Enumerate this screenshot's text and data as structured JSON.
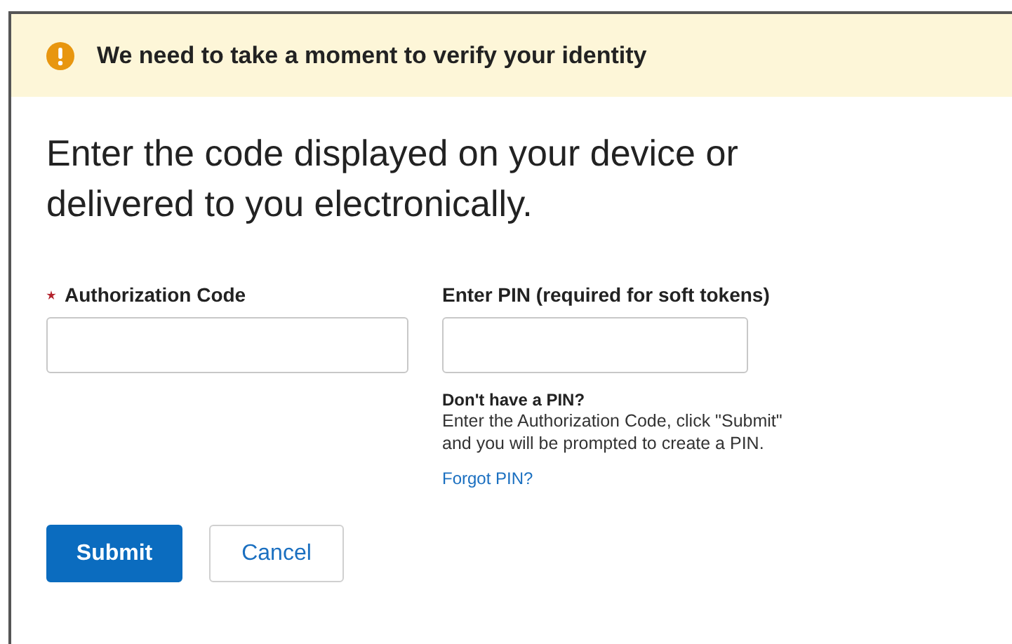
{
  "alert": {
    "kind": "warning",
    "message": "We need to take a moment to verify your identity"
  },
  "heading": "Enter the code displayed on your device or delivered to you electronically.",
  "fields": [
    {
      "label": "Authorization Code",
      "required": true
    },
    {
      "label": "Enter PIN (required for soft tokens)",
      "required": false,
      "help_title": "Don't have a PIN?",
      "help_text": "Enter the Authorization Code, click \"Submit\" and you will be prompted to create a PIN.",
      "link": "Forgot PIN?"
    }
  ],
  "buttons": [
    {
      "label": "Submit",
      "kind": "primary"
    },
    {
      "label": "Cancel",
      "kind": "secondary"
    }
  ]
}
